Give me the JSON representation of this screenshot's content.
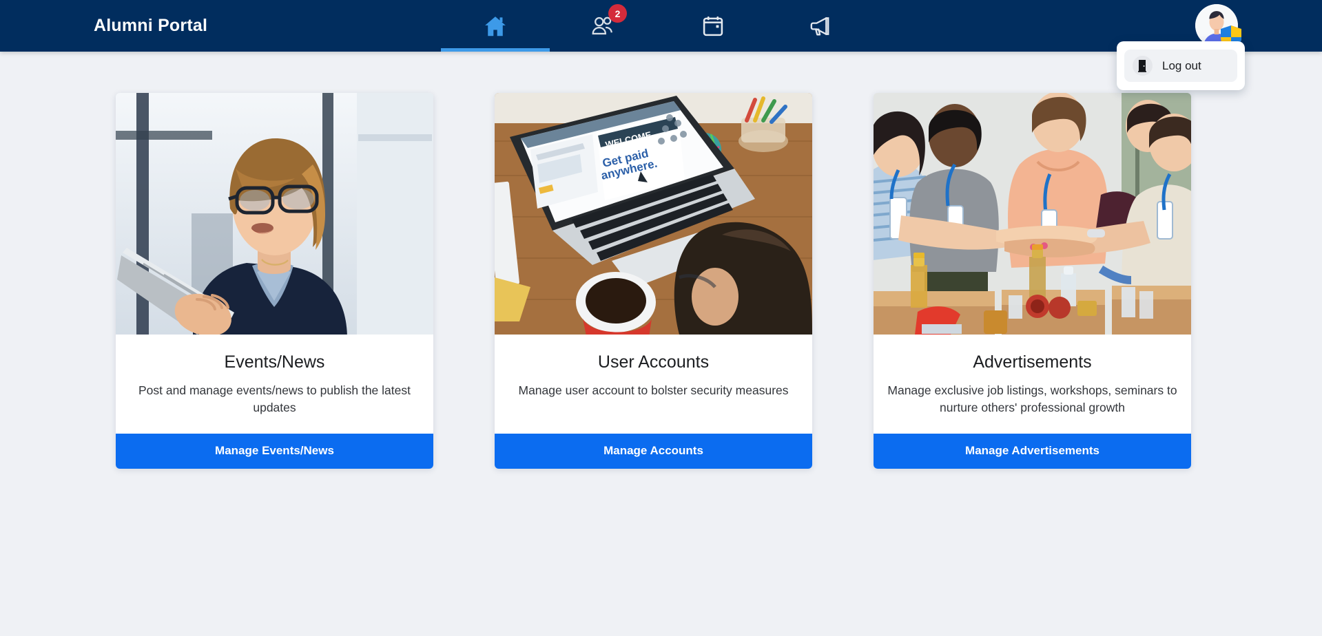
{
  "header": {
    "brand": "Alumni Portal",
    "nav": [
      {
        "name": "home",
        "icon": "home-icon",
        "active": true,
        "badge": null
      },
      {
        "name": "users",
        "icon": "users-icon",
        "active": false,
        "badge": "2"
      },
      {
        "name": "calendar",
        "icon": "calendar-icon",
        "active": false,
        "badge": null
      },
      {
        "name": "announcements",
        "icon": "megaphone-icon",
        "active": false,
        "badge": null
      }
    ],
    "avatar_icon": "user-avatar-with-shield-icon",
    "colors": {
      "header_bg": "#012d5e",
      "active_underline": "#3d9ae8",
      "badge_bg": "#d42b3b",
      "button_blue": "#0b6cf0",
      "page_bg": "#eff1f5"
    }
  },
  "dropdown": {
    "visible": true,
    "logout_icon": "door-exit-icon",
    "logout_label": "Log out"
  },
  "cards": [
    {
      "title": "Events/News",
      "description": "Post and manage events/news to publish the latest updates",
      "button": "Manage Events/News",
      "image_alt": "businesswoman-with-glasses-holding-tablet"
    },
    {
      "title": "User Accounts",
      "description": "Manage user account to bolster security measures",
      "button": "Manage Accounts",
      "image_alt": "man-typing-on-laptop-welcome-get-paid-anywhere-screen-with-coffee"
    },
    {
      "title": "Advertisements",
      "description": "Manage exclusive job listings, workshops, seminars to nurture others' professional growth",
      "button": "Manage Advertisements",
      "image_alt": "volunteers-with-blue-lanyards-joining-hands-over-food-donation-boxes"
    }
  ]
}
